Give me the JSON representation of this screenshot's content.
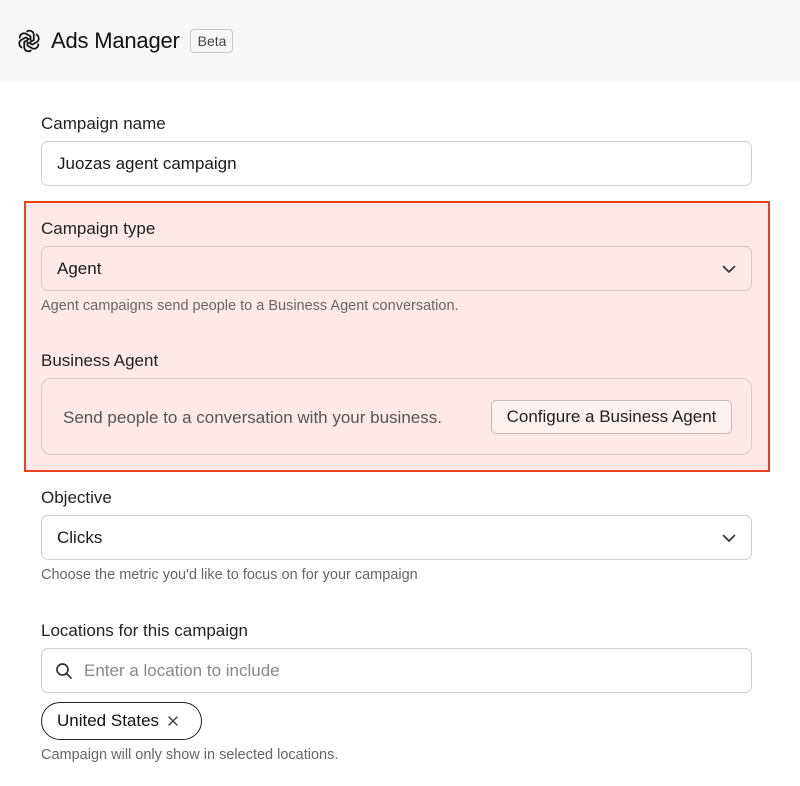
{
  "header": {
    "logo_icon": "openai-logo-icon",
    "title": "Ads Manager",
    "badge": "Beta"
  },
  "campaign_name": {
    "label": "Campaign name",
    "value": "Juozas agent campaign"
  },
  "campaign_type": {
    "label": "Campaign type",
    "selected": "Agent",
    "helper": "Agent campaigns send people to a Business Agent conversation."
  },
  "business_agent": {
    "label": "Business Agent",
    "description": "Send people to a conversation with your business.",
    "button_label": "Configure a Business Agent"
  },
  "objective": {
    "label": "Objective",
    "selected": "Clicks",
    "helper": "Choose the metric you'd like to focus on for your campaign"
  },
  "locations": {
    "label": "Locations for this campaign",
    "placeholder": "Enter a location to include",
    "chips": [
      {
        "label": "United States",
        "remove_icon": "close-icon"
      }
    ],
    "helper": "Campaign will only show in selected locations."
  },
  "colors": {
    "highlight_fill": "#ffe9e8",
    "highlight_border": "#e8421e",
    "header_bg": "#f6f7f6"
  }
}
